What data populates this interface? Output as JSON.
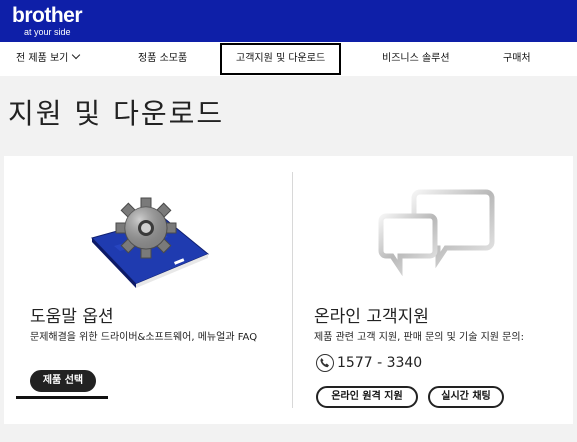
{
  "brand": {
    "name": "brother",
    "tagline": "at your side"
  },
  "nav": {
    "items": [
      {
        "label": "전 제품 보기"
      },
      {
        "label": "정품 소모품"
      },
      {
        "label": "고객지원 및 다운로드"
      },
      {
        "label": "비즈니스 솔루션"
      },
      {
        "label": "구매처"
      }
    ]
  },
  "page": {
    "title": "지원 및 다운로드"
  },
  "help": {
    "title": "도움말 옵션",
    "description": "문제해결을 위한 드라이버&소프트웨어, 메뉴얼과 FAQ",
    "button_label": "제품 선택"
  },
  "online": {
    "title": "온라인 고객지원",
    "description": "제품 관련 고객 지원, 판매 문의 및 기술 지원 문의:",
    "phone": "1577 - 3340",
    "remote_button_label": "온라인 원격 지원",
    "chat_button_label": "실시간 채팅"
  },
  "colors": {
    "brand_blue": "#0e1fa8",
    "hero_bg": "#f2f2f2",
    "book_blue": "#1f3bb0",
    "pill_dark": "#222222"
  },
  "icons": [
    "chevron-down-icon",
    "gear-book-icon",
    "chat-bubbles-icon",
    "phone-icon"
  ]
}
